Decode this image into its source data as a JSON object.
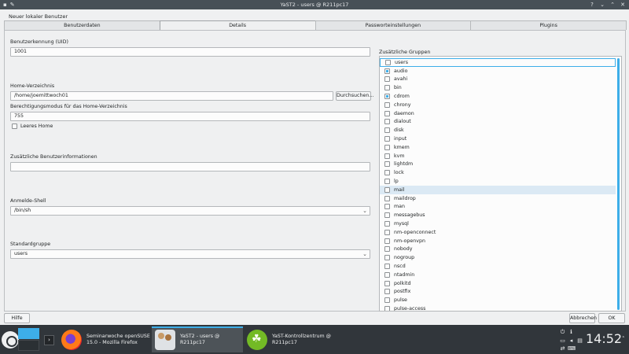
{
  "window": {
    "title": "YaST2 - users @ R211pc17",
    "heading": "Neuer lokaler Benutzer"
  },
  "tabs": [
    "Benutzerdaten",
    "Details",
    "Passworteinstellungen",
    "Plugins"
  ],
  "details": {
    "uid_label": "Benutzerkennung (UID)",
    "uid_value": "1001",
    "home_label": "Home-Verzeichnis",
    "home_value": "/home/joemittwoch01",
    "browse_button": "Durchsuchen...",
    "perm_label": "Berechtigungsmodus für das Home-Verzeichnis",
    "perm_value": "755",
    "empty_home_label": "Leeres Home",
    "info_label": "Zusätzliche Benutzerinformationen",
    "info_value": "",
    "shell_label": "Anmelde-Shell",
    "shell_value": "/bin/sh",
    "group_label": "Standardgruppe",
    "group_value": "users"
  },
  "groups": {
    "label": "Zusätzliche Gruppen",
    "items": [
      {
        "name": "users",
        "checked": false
      },
      {
        "name": "audio",
        "checked": true
      },
      {
        "name": "avahi",
        "checked": false
      },
      {
        "name": "bin",
        "checked": false
      },
      {
        "name": "cdrom",
        "checked": true
      },
      {
        "name": "chrony",
        "checked": false
      },
      {
        "name": "daemon",
        "checked": false
      },
      {
        "name": "dialout",
        "checked": false
      },
      {
        "name": "disk",
        "checked": false
      },
      {
        "name": "input",
        "checked": false
      },
      {
        "name": "kmem",
        "checked": false
      },
      {
        "name": "kvm",
        "checked": false
      },
      {
        "name": "lightdm",
        "checked": false
      },
      {
        "name": "lock",
        "checked": false
      },
      {
        "name": "lp",
        "checked": false
      },
      {
        "name": "mail",
        "checked": false
      },
      {
        "name": "maildrop",
        "checked": false
      },
      {
        "name": "man",
        "checked": false
      },
      {
        "name": "messagebus",
        "checked": false
      },
      {
        "name": "mysql",
        "checked": false
      },
      {
        "name": "nm-openconnect",
        "checked": false
      },
      {
        "name": "nm-openvpn",
        "checked": false
      },
      {
        "name": "nobody",
        "checked": false
      },
      {
        "name": "nogroup",
        "checked": false
      },
      {
        "name": "nscd",
        "checked": false
      },
      {
        "name": "ntadmin",
        "checked": false
      },
      {
        "name": "polkitd",
        "checked": false
      },
      {
        "name": "postfix",
        "checked": false
      },
      {
        "name": "pulse",
        "checked": false
      },
      {
        "name": "pulse-access",
        "checked": false
      }
    ],
    "selected": "mail"
  },
  "buttons": {
    "help": "Hilfe",
    "cancel": "Abbrechen",
    "ok": "OK"
  },
  "taskbar": {
    "tasks": [
      {
        "label": "Seminarwoche openSUSE 15.0 - Mozilla Firefox",
        "icon": "firefox-icon"
      },
      {
        "label": "YaST2 - users @ R211pc17",
        "icon": "users-icon"
      },
      {
        "label": "YaST-Kontrollzentrum @ R211pc17",
        "icon": "yast-icon"
      }
    ],
    "clock": "14:52"
  },
  "colors": {
    "accent": "#3daee9",
    "titlebar": "#475057",
    "taskbar": "#31363b"
  }
}
